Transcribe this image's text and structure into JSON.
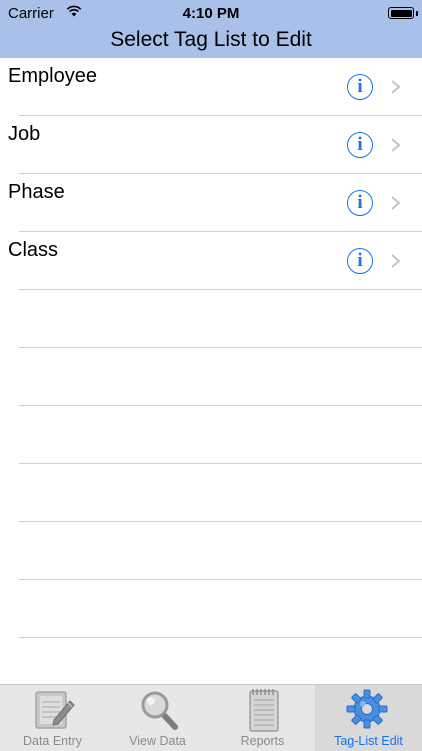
{
  "status_bar": {
    "carrier": "Carrier",
    "time": "4:10 PM"
  },
  "nav": {
    "title": "Select Tag List to Edit"
  },
  "list": {
    "items": [
      {
        "label": "Employee"
      },
      {
        "label": "Job"
      },
      {
        "label": "Phase"
      },
      {
        "label": "Class"
      }
    ]
  },
  "tabbar": {
    "tabs": [
      {
        "label": "Data Entry",
        "icon": "notepad-pencil-icon"
      },
      {
        "label": "View Data",
        "icon": "magnifier-icon"
      },
      {
        "label": "Reports",
        "icon": "notebook-icon"
      },
      {
        "label": "Tag-List Edit",
        "icon": "gear-icon",
        "active": true
      }
    ]
  },
  "colors": {
    "header_bg": "#a9c1e8",
    "accent": "#1b6fe6",
    "separator": "#d0d0d0"
  }
}
